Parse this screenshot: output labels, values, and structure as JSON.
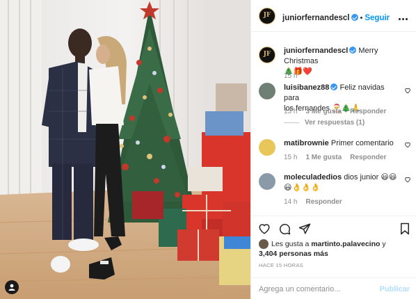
{
  "post": {
    "author": "juniorfernandescl",
    "follow_label": "Seguir",
    "separator": "•",
    "caption_text": "Merry Christmas",
    "caption_emoji_line": "🎄🎁❤️",
    "caption_time": "15 h"
  },
  "comments": [
    {
      "username": "luisibanez88",
      "verified": true,
      "text_line1": "Feliz navidas para",
      "text_line2": "los fernandes 🎅🎄🙏",
      "time": "13 h",
      "likes": "3 Me gusta",
      "reply": "Responder",
      "view_replies": "Ver respuestas (1)"
    },
    {
      "username": "matibrownie",
      "verified": false,
      "text_line1": "Primer comentario",
      "time": "15 h",
      "likes": "1 Me gusta",
      "reply": "Responder"
    },
    {
      "username": "moleculadedios",
      "verified": false,
      "text_line1": "dios junior 😃😃",
      "text_line2": "😃👌👌👌",
      "time": "14 h",
      "reply": "Responder"
    }
  ],
  "engagement": {
    "likes_prefix": "Les gusta a",
    "liked_by": "martinto.palavecino",
    "likes_and": "y",
    "others_count": "3,404 personas más",
    "posted_ago": "HACE 15 HORAS"
  },
  "add_comment": {
    "placeholder": "Agrega un comentario...",
    "post_label": "Publicar"
  },
  "colors": {
    "accent": "#0095f6",
    "verified": "#3897f0",
    "muted": "#8e8e8e"
  },
  "icons": [
    "more-icon",
    "heart-icon",
    "comment-icon",
    "share-icon",
    "bookmark-icon",
    "tag-user-icon",
    "verified-icon"
  ]
}
